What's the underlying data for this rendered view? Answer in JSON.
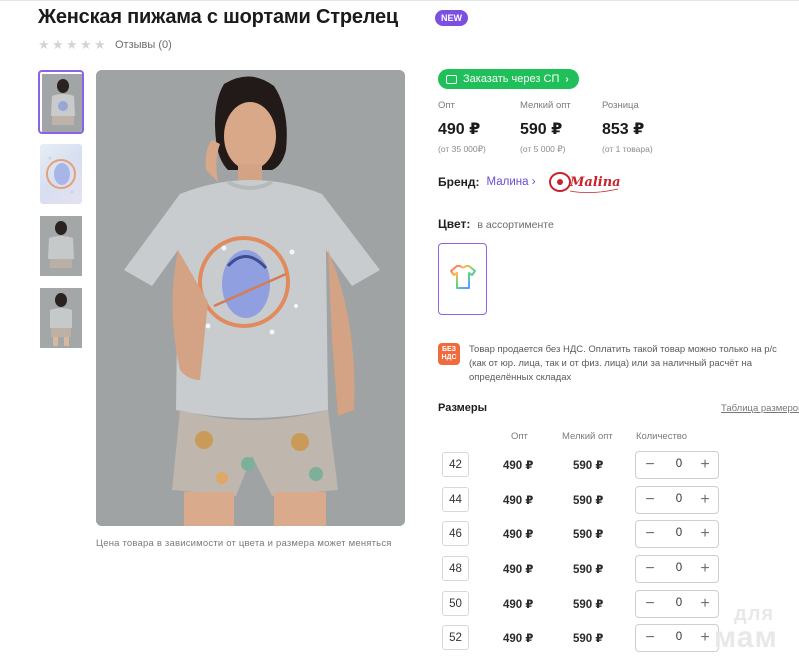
{
  "product": {
    "title": "Женская пижама с шортами Стрелец",
    "badge": "NEW",
    "stars": 5,
    "reviews_label": "Отзывы (0)",
    "price_note": "Цена товара в зависимости от цвета и размера может меняться"
  },
  "order": {
    "button_label": "Заказать через СП"
  },
  "prices": [
    {
      "label": "Опт",
      "value": "490 ₽",
      "sub": "(от 35 000₽)"
    },
    {
      "label": "Мелкий опт",
      "value": "590 ₽",
      "sub": "(от 5 000 ₽)"
    },
    {
      "label": "Розница",
      "value": "853 ₽",
      "sub": "(от 1 товара)"
    }
  ],
  "brand": {
    "label": "Бренд:",
    "name": "Малина",
    "logo_text": "Malina"
  },
  "color": {
    "label": "Цвет:",
    "value": "в ассортименте"
  },
  "vat": {
    "icon_line1": "БЕЗ",
    "icon_line2": "НДС",
    "text": "Товар продается без НДС. Оплатить такой товар можно только на р/с (как от юр. лица, так и от физ. лица) или за наличный расчёт на определённых складах"
  },
  "sizes": {
    "title": "Размеры",
    "chart_link": "Таблица размеров",
    "headers": {
      "opt": "Опт",
      "small_opt": "Мелкий опт",
      "qty": "Количество"
    },
    "rows": [
      {
        "size": "42",
        "opt": "490 ₽",
        "small_opt": "590 ₽",
        "qty": "0"
      },
      {
        "size": "44",
        "opt": "490 ₽",
        "small_opt": "590 ₽",
        "qty": "0"
      },
      {
        "size": "46",
        "opt": "490 ₽",
        "small_opt": "590 ₽",
        "qty": "0"
      },
      {
        "size": "48",
        "opt": "490 ₽",
        "small_opt": "590 ₽",
        "qty": "0"
      },
      {
        "size": "50",
        "opt": "490 ₽",
        "small_opt": "590 ₽",
        "qty": "0"
      },
      {
        "size": "52",
        "opt": "490 ₽",
        "small_opt": "590 ₽",
        "qty": "0"
      }
    ],
    "minus_symbol": "−",
    "plus_symbol": "+"
  },
  "watermark": {
    "line1": "для",
    "line2": "мам"
  },
  "colors": {
    "accent": "#8a63e6",
    "order_green": "#1fbf59",
    "badge_purple": "#7b4fe0",
    "brand_link": "#6a4ad6",
    "vat_orange": "#ef6b3d",
    "photo_bg": "#9fa3a4"
  },
  "icons": {
    "order": "cart-icon",
    "brand": "chevron-right-icon",
    "star": "star-icon",
    "color": "tshirt-icon"
  }
}
